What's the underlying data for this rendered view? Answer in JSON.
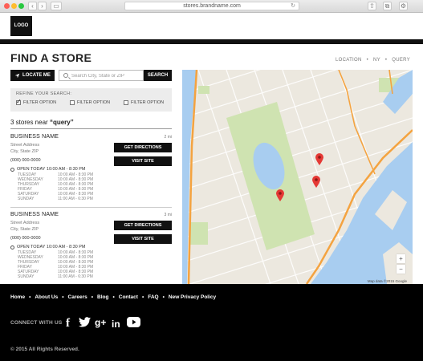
{
  "browser": {
    "url": "stores.brandname.com"
  },
  "header": {
    "logo_text": "LOGO"
  },
  "page": {
    "title": "FIND A STORE",
    "breadcrumb": [
      "LOCATION",
      "NY",
      "QUERY"
    ]
  },
  "search": {
    "locate_label": "LOCATE ME",
    "placeholder": "Search City, State or ZIP",
    "value": "",
    "search_label": "SEARCH"
  },
  "refine": {
    "label": "REFINE YOUR SEARCH:",
    "filters": [
      {
        "label": "FILTER OPTION",
        "checked": true
      },
      {
        "label": "FILTER OPTION",
        "checked": false
      },
      {
        "label": "FILTER OPTION",
        "checked": false
      }
    ]
  },
  "results": {
    "count_text": "3 stores near",
    "query_text": "“query”"
  },
  "stores": [
    {
      "name": "BUSINESS NAME",
      "distance": "2 mi",
      "street": "Street Address",
      "city": "City, State ZIP",
      "phone": "(000) 000-0000",
      "directions_label": "GET DIRECTIONS",
      "visit_label": "VISIT SITE",
      "open_text": "OPEN TODAY 10:00 AM - 8:30 PM",
      "hours": [
        {
          "day": "TUESDAY",
          "time": "10:00 AM - 8:30 PM"
        },
        {
          "day": "WEDNESDAY",
          "time": "10:00 AM - 8:30 PM"
        },
        {
          "day": "THURSDAY",
          "time": "10:00 AM - 8:30 PM"
        },
        {
          "day": "FRIDAY",
          "time": "10:00 AM - 8:30 PM"
        },
        {
          "day": "SATURDAY",
          "time": "10:00 AM - 8:30 PM"
        },
        {
          "day": "SUNDAY",
          "time": "11:00 AM - 6:30 PM"
        }
      ]
    },
    {
      "name": "BUSINESS NAME",
      "distance": "3 mi",
      "street": "Street Address",
      "city": "City, State ZIP",
      "phone": "(000) 000-0000",
      "directions_label": "GET DIRECTIONS",
      "visit_label": "VISIT SITE",
      "open_text": "OPEN TODAY 10:00 AM - 8:30 PM",
      "hours": [
        {
          "day": "TUESDAY",
          "time": "10:00 AM - 8:30 PM"
        },
        {
          "day": "WEDNESDAY",
          "time": "10:00 AM - 8:30 PM"
        },
        {
          "day": "THURSDAY",
          "time": "10:00 AM - 8:30 PM"
        },
        {
          "day": "FRIDAY",
          "time": "10:00 AM - 8:30 PM"
        },
        {
          "day": "SATURDAY",
          "time": "10:00 AM - 8:30 PM"
        },
        {
          "day": "SUNDAY",
          "time": "11:00 AM - 6:30 PM"
        }
      ]
    }
  ],
  "map": {
    "zoom_in": "+",
    "zoom_out": "−",
    "attribution": "Map data ©2015 Google",
    "pin_color": "#e53935",
    "water_color": "#a8cdf0",
    "park_color": "#cfe3b1",
    "highway_color": "#f4a340"
  },
  "footer": {
    "nav": [
      "Home",
      "About Us",
      "Careers",
      "Blog",
      "Contact",
      "FAQ",
      "New Privacy Policy"
    ],
    "connect_label": "CONNECT WITH US",
    "social": [
      {
        "icon": "facebook-icon",
        "glyph": "f"
      },
      {
        "icon": "twitter-icon",
        "glyph": "t"
      },
      {
        "icon": "google-plus-icon",
        "glyph": "g+"
      },
      {
        "icon": "linkedin-icon",
        "glyph": "in"
      },
      {
        "icon": "youtube-icon",
        "glyph": "▶"
      }
    ],
    "copyright": "© 2015 All Rights Reserved."
  }
}
